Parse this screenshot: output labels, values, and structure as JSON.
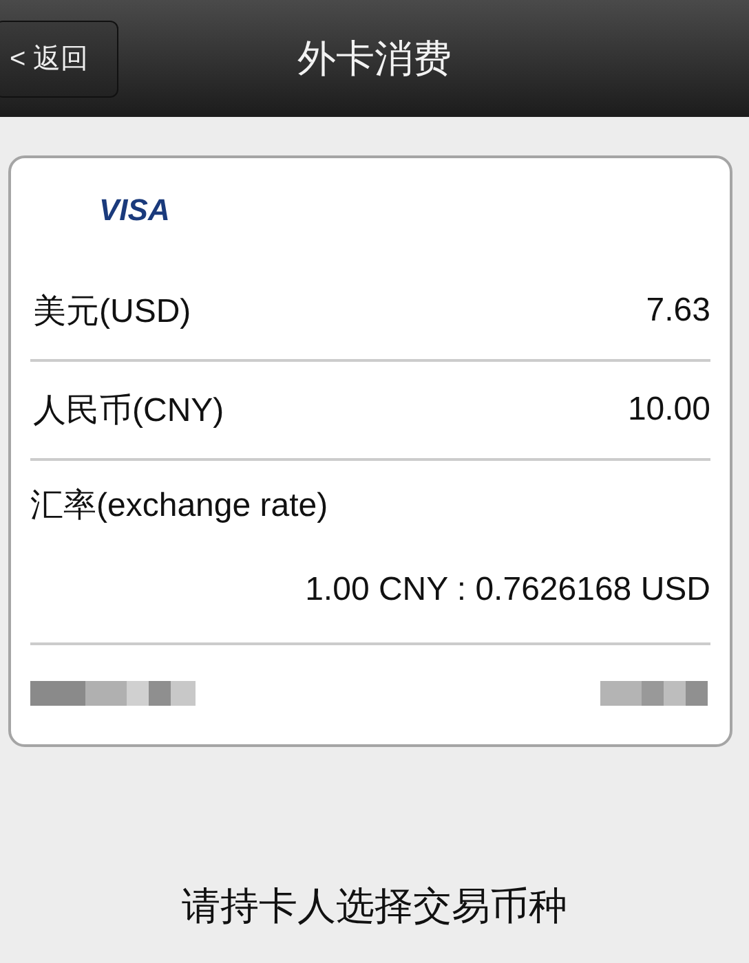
{
  "header": {
    "back_button": {
      "icon": "<",
      "label": "返回"
    },
    "title": "外卡消费"
  },
  "card": {
    "logo": "VISA",
    "rows": [
      {
        "label": "美元(USD)",
        "value": "7.63"
      },
      {
        "label": "人民币(CNY)",
        "value": "10.00"
      }
    ],
    "rate": {
      "label": "汇率(exchange rate)",
      "value": "1.00 CNY : 0.7626168 USD"
    }
  },
  "prompt": "请持卡人选择交易币种"
}
